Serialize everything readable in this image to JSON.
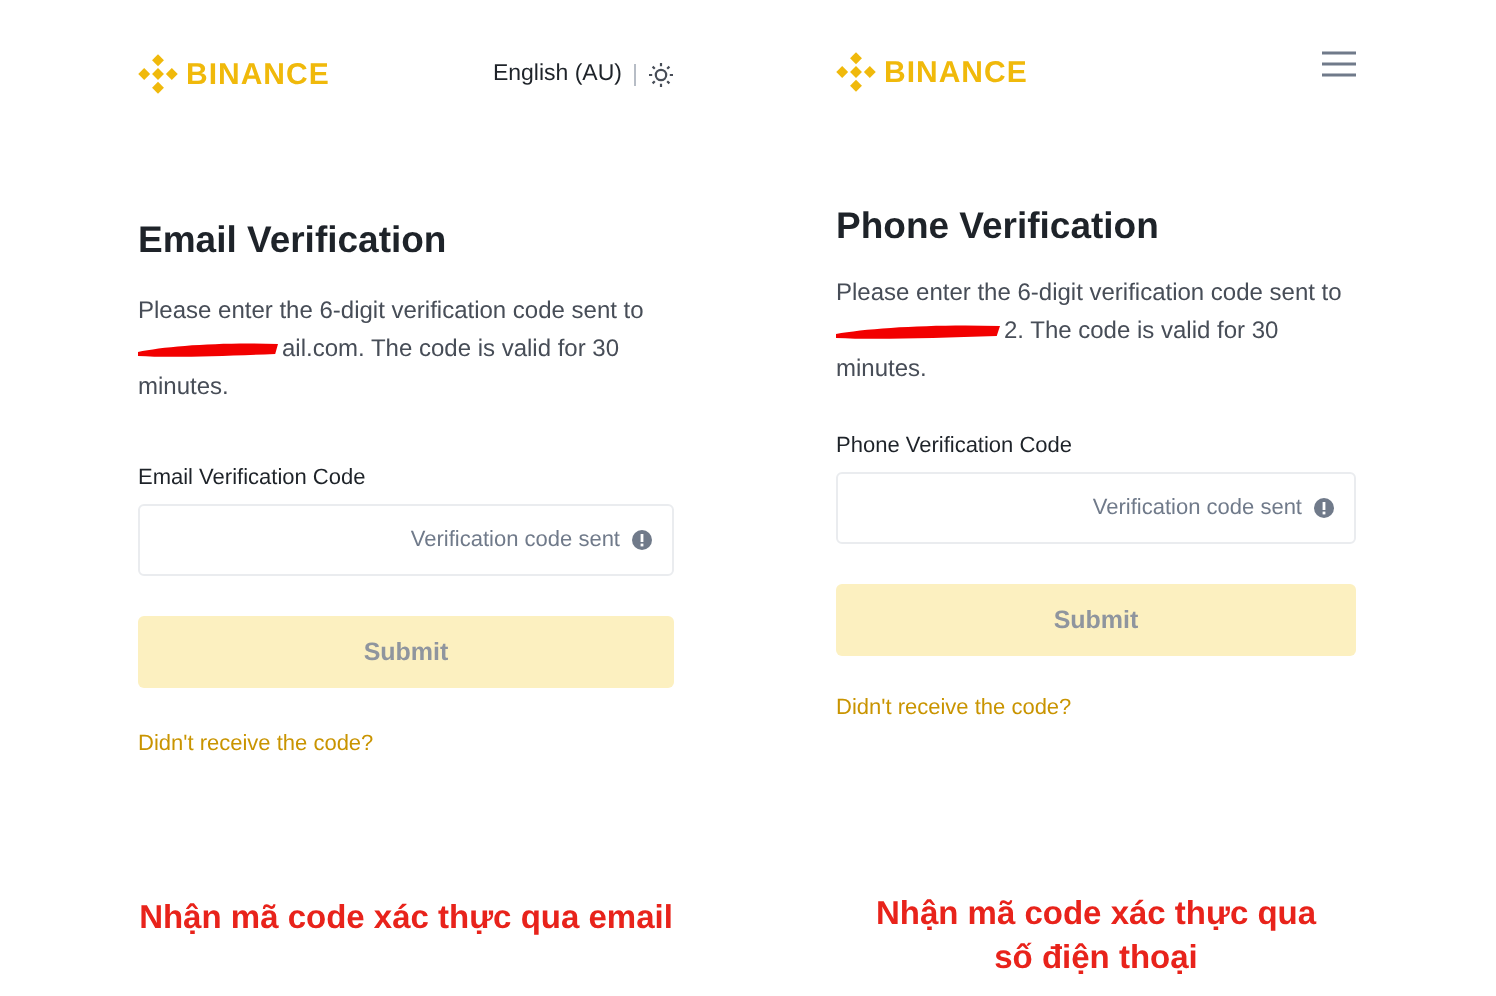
{
  "screens": [
    {
      "header": {
        "kind": "language",
        "logo": "BINANCE",
        "language": "English (AU)"
      },
      "title": "Email Verification",
      "description": "Please enter the 6-digit verification code sent to",
      "redacted": true,
      "description_rest": "ail.com. The code is valid for 30 minutes.",
      "field_label": "Email Verification Code",
      "field_status": "Verification code sent",
      "submit": {
        "label": "Submit",
        "disabled": true
      },
      "link": "Didn't receive the code?",
      "caption": "Nhận mã code xác thực qua email"
    },
    {
      "header": {
        "kind": "menu",
        "logo": "BINANCE"
      },
      "title": "Phone Verification",
      "description": "Please enter the 6-digit verification code sent to",
      "redacted": true,
      "description_rest": "2. The code is valid for 30 minutes.",
      "field_label": "Phone Verification Code",
      "field_status": "Verification code sent",
      "submit": {
        "label": "Submit",
        "disabled": true
      },
      "link": "Didn't receive the code?",
      "caption": "Nhận mã code xác thực qua số điện thoại"
    }
  ]
}
